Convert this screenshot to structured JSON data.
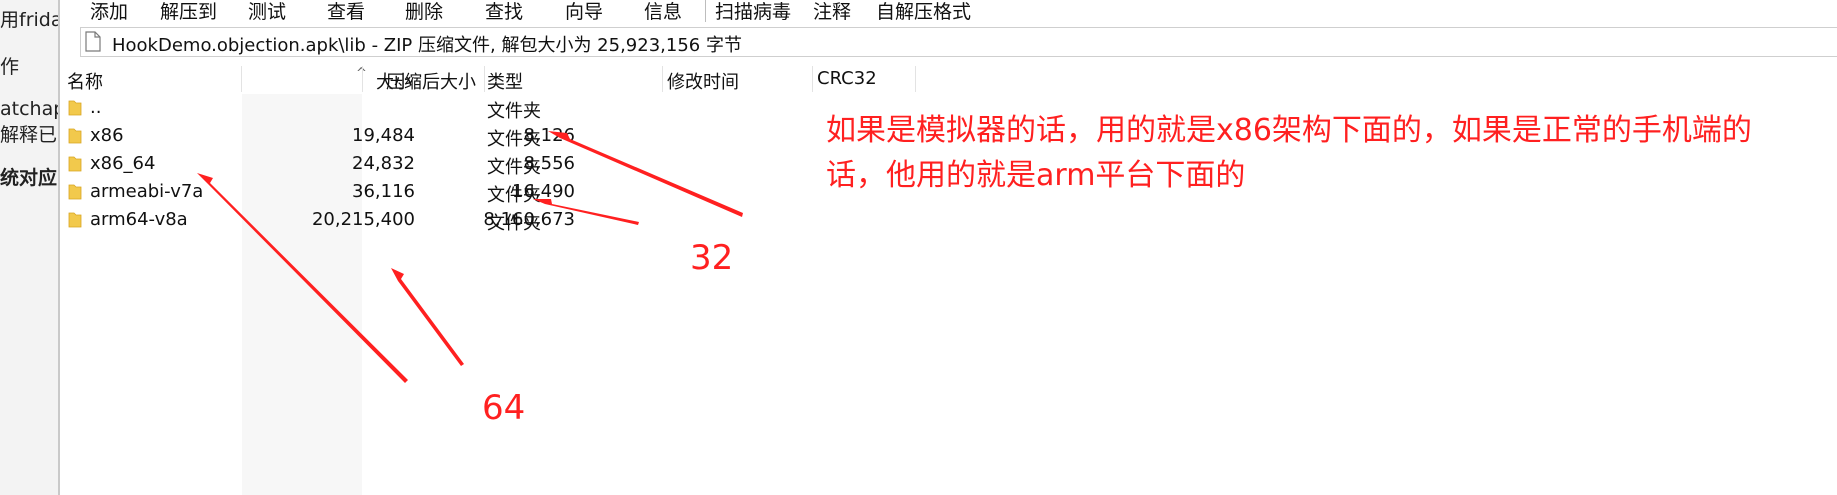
{
  "left_strip": {
    "lines": [
      "用frida",
      "作",
      "atchapk",
      "解释已",
      "统对应"
    ]
  },
  "toolbar": {
    "items": [
      "添加",
      "解压到",
      "测试",
      "查看",
      "删除",
      "查找",
      "向导",
      "信息",
      "扫描病毒",
      "注释",
      "自解压格式"
    ]
  },
  "address_bar": {
    "text": "HookDemo.objection.apk\\lib - ZIP 压缩文件, 解包大小为 25,923,156 字节"
  },
  "columns": [
    "名称",
    "大小",
    "压缩后大小",
    "类型",
    "修改时间",
    "CRC32"
  ],
  "rows": [
    {
      "name": "..",
      "size": "",
      "compressed": "",
      "type": "文件夹"
    },
    {
      "name": "x86",
      "size": "19,484",
      "compressed": "8,126",
      "type": "文件夹"
    },
    {
      "name": "x86_64",
      "size": "24,832",
      "compressed": "8,556",
      "type": "文件夹"
    },
    {
      "name": "armeabi-v7a",
      "size": "36,116",
      "compressed": "16,490",
      "type": "文件夹"
    },
    {
      "name": "arm64-v8a",
      "size": "20,215,400",
      "compressed": "8,160,673",
      "type": "文件夹"
    }
  ],
  "annotations": {
    "note_line1": "如果是模拟器的话，用的就是x86架构下面的，如果是正常的手机端的",
    "note_line2": "话，他用的就是arm平台下面的",
    "label_32": "32",
    "label_64": "64"
  },
  "colors": {
    "annotation": "#ff2020",
    "folder": "#f2c94c"
  }
}
